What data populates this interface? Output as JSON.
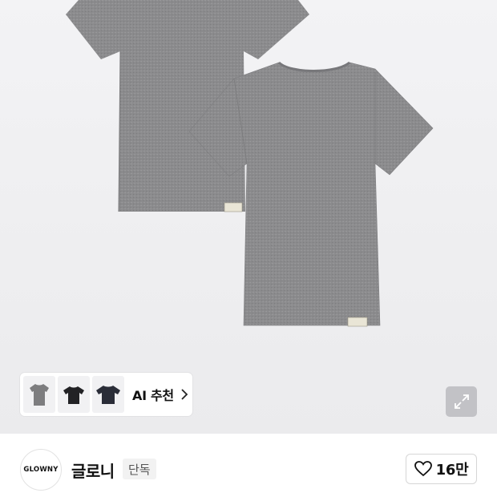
{
  "product": {
    "image_icon": "gray-tshirt-pair-image"
  },
  "recommendation": {
    "label": "AI 추천",
    "thumbnails": [
      {
        "icon": "gray-tshirt-thumbnail",
        "color": "#7d7d7f"
      },
      {
        "icon": "black-tshirt-thumbnail",
        "color": "#222225"
      },
      {
        "icon": "navy-tshirt-thumbnail",
        "color": "#2a2d38"
      }
    ],
    "chevron_icon": "chevron-right-icon"
  },
  "expand": {
    "icon": "expand-arrows-icon"
  },
  "brand": {
    "logo_text": "GLOWNY",
    "name": "글로니",
    "badge": "단독"
  },
  "like": {
    "icon": "heart-icon",
    "count": "16만"
  },
  "colors": {
    "shirt_gray": "#8a8a8c",
    "hero_bg": "#efeff1",
    "badge_bg": "#f2f2f2"
  }
}
